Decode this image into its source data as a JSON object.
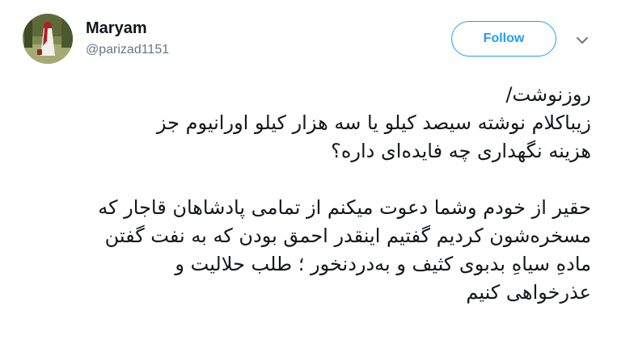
{
  "user": {
    "display_name": "Maryam",
    "handle": "@parizad1151"
  },
  "actions": {
    "follow_label": "Follow",
    "more_icon": "chevron-down-icon"
  },
  "tweet": {
    "lines": [
      "روزنوشت/",
      "زیباکلام نوشته سیصد کیلو یا سه هزار کیلو اورانیوم جز",
      "هزینه نگهداری چه فایده‌ای داره؟",
      "",
      "حقیر از خودم وشما دعوت میکنم از تمامی پادشاهان قاجار که",
      "مسخره‌شون کردیم گفتیم اینقدر احمق بودن که به نفت گفتن",
      "مادهِ سیاهِ بدبوی کثیف و به‌دردنخور ؛ طلب حلالیت و",
      "عذرخواهی کنیم"
    ]
  },
  "colors": {
    "accent": "#1da1f2",
    "text": "#14171a",
    "muted": "#657786"
  }
}
